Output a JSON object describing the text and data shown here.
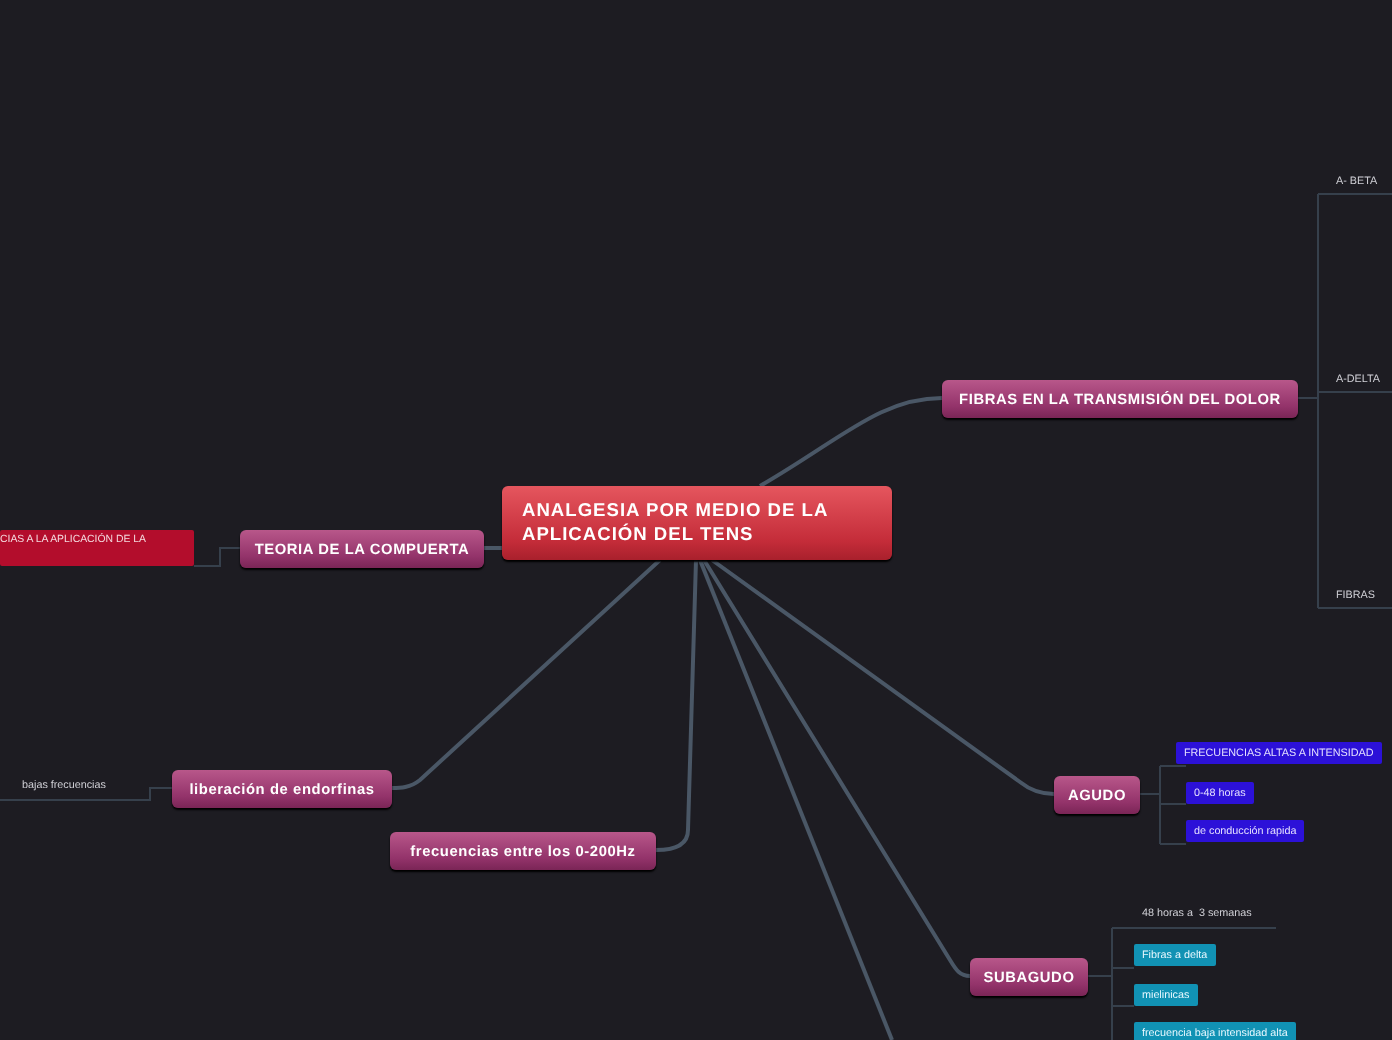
{
  "map": {
    "central": {
      "title": "ANALGESIA POR MEDIO DE LA APLICACIÓN DEL TENS"
    },
    "branches": [
      {
        "title": "FIBRAS EN LA TRANSMISIÓN DEL DOLOR",
        "children": [
          {
            "kind": "plain",
            "text": "A- BETA"
          },
          {
            "kind": "plain",
            "text": "A-DELTA"
          },
          {
            "kind": "plain",
            "text": "FIBRAS"
          }
        ]
      },
      {
        "title": "TEORIA DE LA COMPUERTA",
        "children": [
          {
            "kind": "red",
            "text": "CIAS A LA APLICACIÓN DE LA"
          }
        ]
      },
      {
        "title": "liberación de endorfinas",
        "children": [
          {
            "kind": "plain",
            "text": "bajas frecuencias"
          }
        ]
      },
      {
        "title": "frecuencias entre los 0-200Hz"
      },
      {
        "title": "AGUDO",
        "children": [
          {
            "kind": "blue",
            "text": "FRECUENCIAS ALTAS A INTENSIDAD"
          },
          {
            "kind": "blue",
            "text": "0-48 horas"
          },
          {
            "kind": "blue",
            "text": "de conducción rapida"
          }
        ]
      },
      {
        "title": "SUBAGUDO",
        "children": [
          {
            "kind": "plain",
            "text": "48 horas a  3 semanas"
          },
          {
            "kind": "cyan",
            "text": "Fibras a delta"
          },
          {
            "kind": "cyan",
            "text": "mielinicas"
          },
          {
            "kind": "cyan",
            "text": "frecuencia baja intensidad alta"
          }
        ]
      }
    ]
  }
}
